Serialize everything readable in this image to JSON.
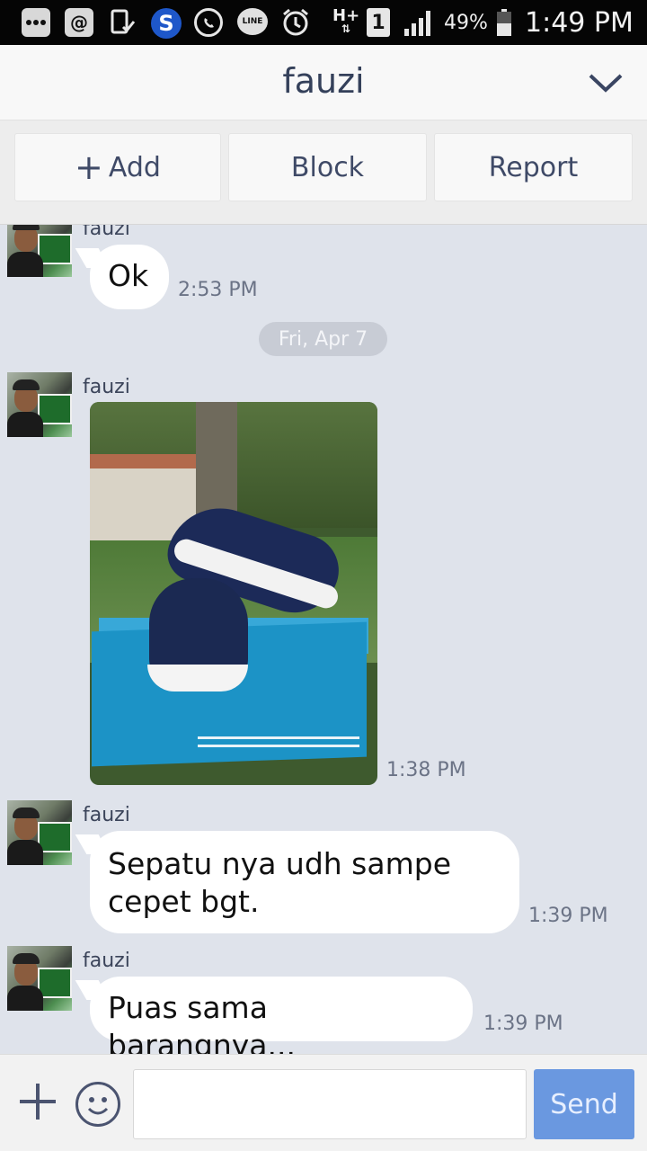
{
  "status_bar": {
    "icons": [
      "more-icon",
      "at-icon",
      "device-check-icon",
      "s-icon",
      "whatsapp-icon",
      "line-icon",
      "alarm-icon",
      "hplus-icon",
      "sim-1-icon",
      "signal-icon",
      "battery-icon"
    ],
    "network": "H+",
    "sim": "1",
    "battery": "49%",
    "time": "1:49 PM",
    "line_badge": "LINE"
  },
  "header": {
    "title": "fauzi"
  },
  "actions": {
    "add_label": "Add",
    "block_label": "Block",
    "report_label": "Report"
  },
  "messages": [
    {
      "sender": "fauzi",
      "text": "Ok",
      "time": "2:53 PM"
    },
    {
      "sender": "fauzi",
      "type": "image",
      "time": "1:38 PM"
    },
    {
      "sender": "fauzi",
      "text_line1": "Sepatu nya udh sampe",
      "text_line2": "cepet bgt.",
      "time": "1:39 PM"
    },
    {
      "sender": "fauzi",
      "text": "Puas sama barangnya...",
      "time": "1:39 PM"
    }
  ],
  "date_separator": "Fri, Apr 7",
  "composer": {
    "placeholder": "",
    "send_label": "Send"
  },
  "colors": {
    "accent": "#34405a",
    "chat_bg": "#dfe3eb",
    "send_button": "#6a98e0"
  }
}
